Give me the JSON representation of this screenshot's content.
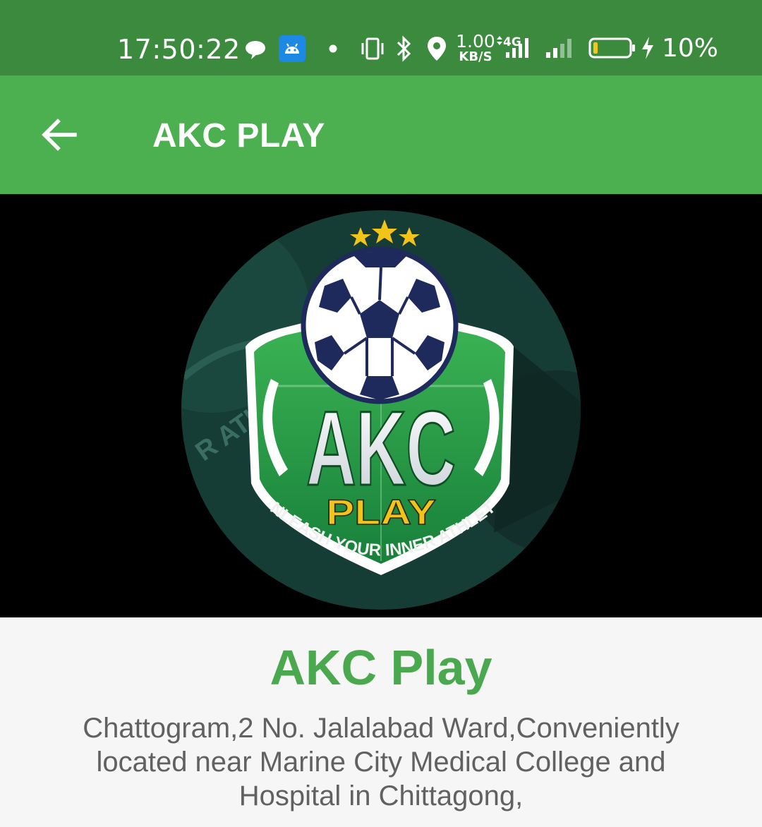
{
  "status_bar": {
    "time": "17:50:22",
    "net_speed_value": "1.00",
    "net_speed_unit": "KB/S",
    "net_type": "4G",
    "battery_percent": "10%",
    "icons": [
      "chat-bubble-icon",
      "android-debug-icon",
      "dot-icon",
      "vibrate-icon",
      "bluetooth-icon",
      "location-icon",
      "signal-4g-icon",
      "signal-icon",
      "battery-icon",
      "charging-icon"
    ]
  },
  "app_bar": {
    "title": "AKC PLAY",
    "back_icon": "arrow-left-icon"
  },
  "banner": {
    "logo_main": "AKC",
    "logo_sub": "PLAY",
    "logo_tagline": "UNLEASH YOUR INNER ATHLETE",
    "logo_bg_text": "R ATHLETE",
    "colors": {
      "shield_green": "#2e9e44",
      "gold": "#f2c318",
      "navy": "#1f2a5c"
    }
  },
  "venue": {
    "name": "AKC Play",
    "address": "Chattogram,2 No. Jalalabad Ward,Conveniently located near Marine City Medical College and Hospital in Chittagong,"
  }
}
